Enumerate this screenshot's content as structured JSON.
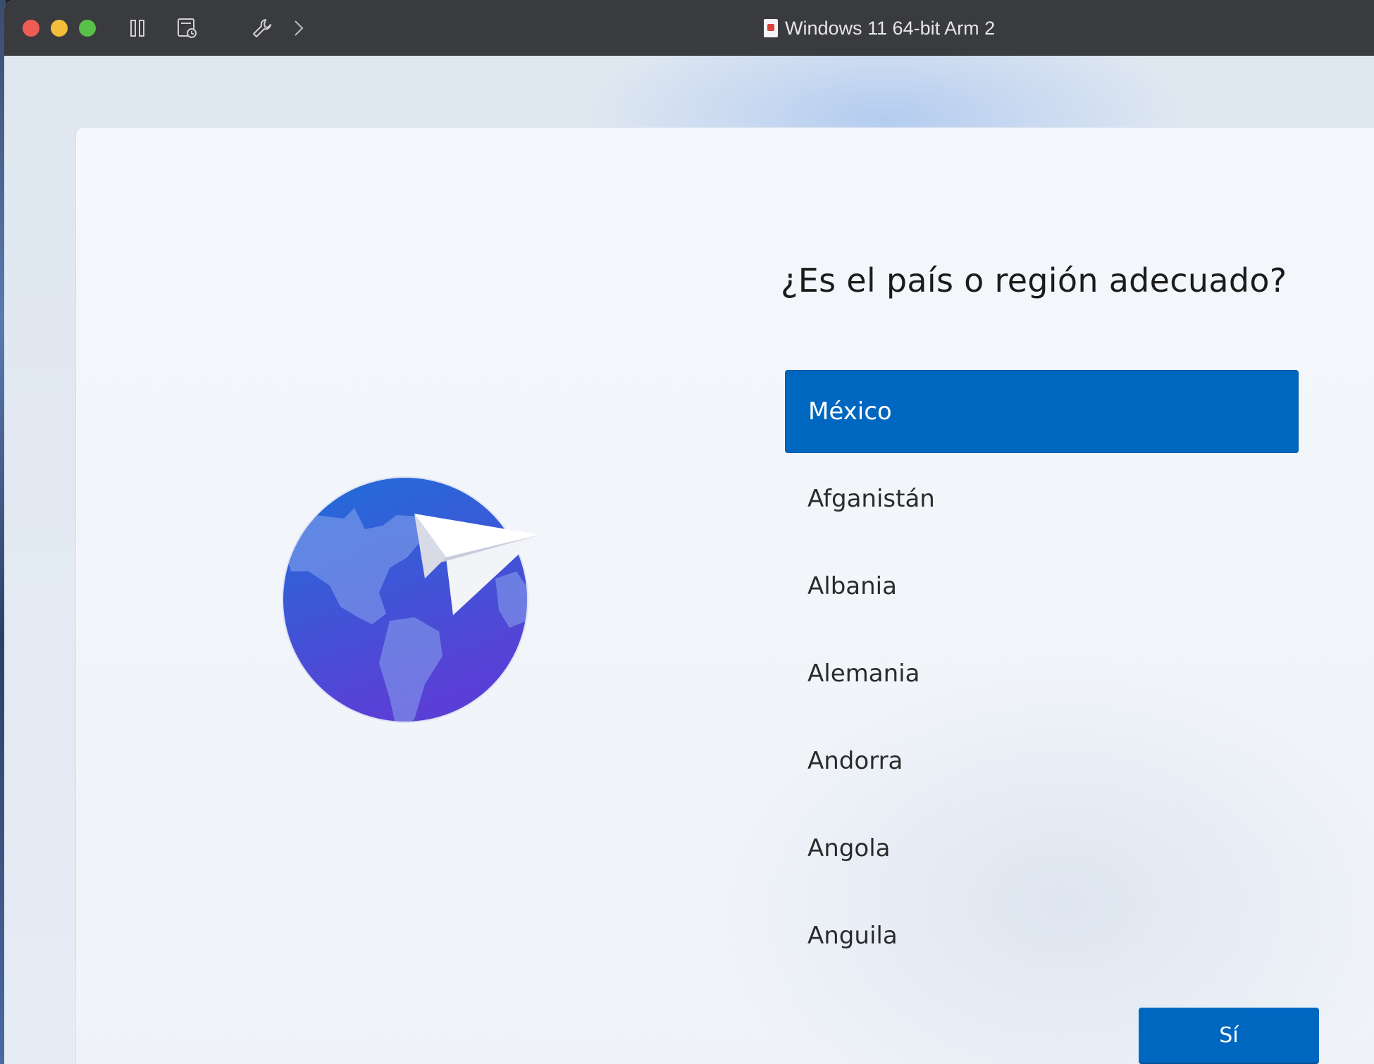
{
  "titlebar": {
    "title": "Windows 11 64-bit Arm 2",
    "icons": [
      "pause-icon",
      "snapshot-icon",
      "wrench-icon",
      "chevron-right-icon"
    ]
  },
  "setup": {
    "question": "¿Es el país o región adecuado?",
    "countries": [
      "México",
      "Afganistán",
      "Albania",
      "Alemania",
      "Andorra",
      "Angola",
      "Anguila"
    ],
    "selected_index": 0,
    "yes_label": "Sí"
  },
  "colors": {
    "accent": "#0067c0",
    "globe_top": "#1f6fd8",
    "globe_bottom": "#5a3fd6"
  }
}
